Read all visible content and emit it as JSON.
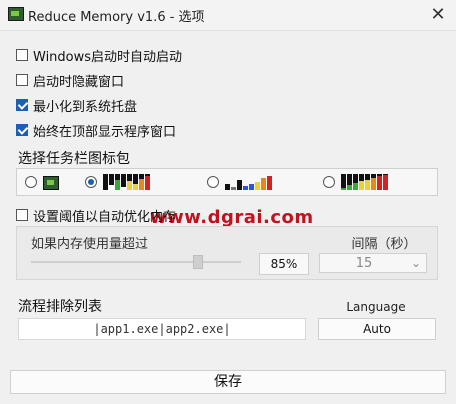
{
  "window": {
    "title": "Reduce Memory v1.6 - 选项",
    "close": "✕"
  },
  "options": {
    "windows_startup": {
      "label": "Windows启动时自动启动",
      "checked": false
    },
    "hide_on_start": {
      "label": "启动时隐藏窗口",
      "checked": false
    },
    "minimize_to_tray": {
      "label": "最小化到系统托盘",
      "checked": true
    },
    "always_on_top": {
      "label": "始终在顶部显示程序窗口",
      "checked": true
    }
  },
  "taskbar_icon": {
    "label": "选择任务栏图标包",
    "selected_index": 1
  },
  "auto_optimize": {
    "label": "设置阈值以自动优化内存",
    "checked": false,
    "threshold_label": "如果内存使用量超过",
    "threshold_value": "85%",
    "threshold_fraction": 0.85,
    "interval_label": "间隔（秒）",
    "interval_value": "15"
  },
  "exclusions": {
    "label": "流程排除列表",
    "value": "|app1.exe|app2.exe|"
  },
  "language": {
    "label": "Language",
    "value": "Auto"
  },
  "save": {
    "label": "保存"
  },
  "watermark": {
    "text": "www.dgrai.com"
  },
  "colors": {
    "accent": "#1a5fb4",
    "watermark": "#c1121f"
  }
}
